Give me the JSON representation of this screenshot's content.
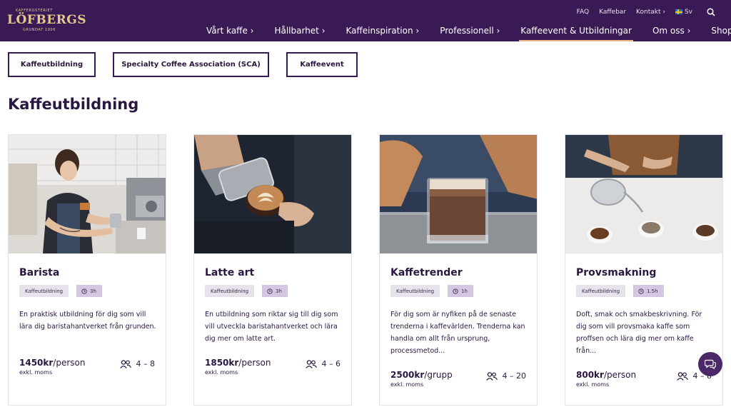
{
  "brand": {
    "tagline": "KAFFEROSTERIET",
    "name": "LÖFBERGS",
    "established": "GRUNDAT 1906"
  },
  "utility_nav": {
    "faq": "FAQ",
    "coffee_bar": "Kaffebar",
    "contact": "Kontakt ›",
    "language": "Sv",
    "search_icon": "search-icon"
  },
  "main_nav": [
    {
      "label": "Vårt kaffe ›"
    },
    {
      "label": "Hållbarhet ›"
    },
    {
      "label": "Kaffeinspiration ›"
    },
    {
      "label": "Professionell ›"
    },
    {
      "label": "Kaffeevent & Utbildningar"
    },
    {
      "label": "Om oss ›"
    },
    {
      "label": "Shop"
    }
  ],
  "filters": [
    {
      "label": "Kaffeutbildning"
    },
    {
      "label": "Specialty Coffee Association (SCA)"
    },
    {
      "label": "Kaffeevent"
    }
  ],
  "page_title": "Kaffeutbildning",
  "cards": [
    {
      "title": "Barista",
      "category": "Kaffeutbildning",
      "duration": "3h",
      "description": "En praktisk utbildning för dig som vill lära dig baristahantverket från grunden.",
      "price_amount": "1450kr",
      "price_unit": "/person",
      "vat_note": "exkl. moms",
      "participants": "4 – 8"
    },
    {
      "title": "Latte art",
      "category": "Kaffeutbildning",
      "duration": "3h",
      "description": "En utbildning som riktar sig till dig som vill utveckla baristahantverket och lära dig mer om latte art.",
      "price_amount": "1850kr",
      "price_unit": "/person",
      "vat_note": "exkl. moms",
      "participants": "4 – 6"
    },
    {
      "title": "Kaffetrender",
      "category": "Kaffeutbildning",
      "duration": "1h",
      "description": "För dig som är nyfiken på de senaste trenderna i kaffevärlden. Trenderna kan handla om allt från ursprung, processmetod...",
      "price_amount": "2500kr",
      "price_unit": "/grupp",
      "vat_note": "exkl. moms",
      "participants": "4 – 20"
    },
    {
      "title": "Provsmakning",
      "category": "Kaffeutbildning",
      "duration": "1.5h",
      "description": "Doft, smak och smakbeskrivning. För dig som vill provsmaka kaffe som proffsen och lära dig mer om kaffe från...",
      "price_amount": "800kr",
      "price_unit": "/person",
      "vat_note": "exkl. moms",
      "participants": "4 – 8"
    }
  ],
  "colors": {
    "header_bg": "#3a1a54",
    "brand_gold": "#e4c98e",
    "active_underline": "#e9b98a",
    "text_primary": "#2a1740",
    "badge_category": "#e6e3ea",
    "badge_time": "#d4c8e0",
    "chat_button": "#4b2968"
  }
}
